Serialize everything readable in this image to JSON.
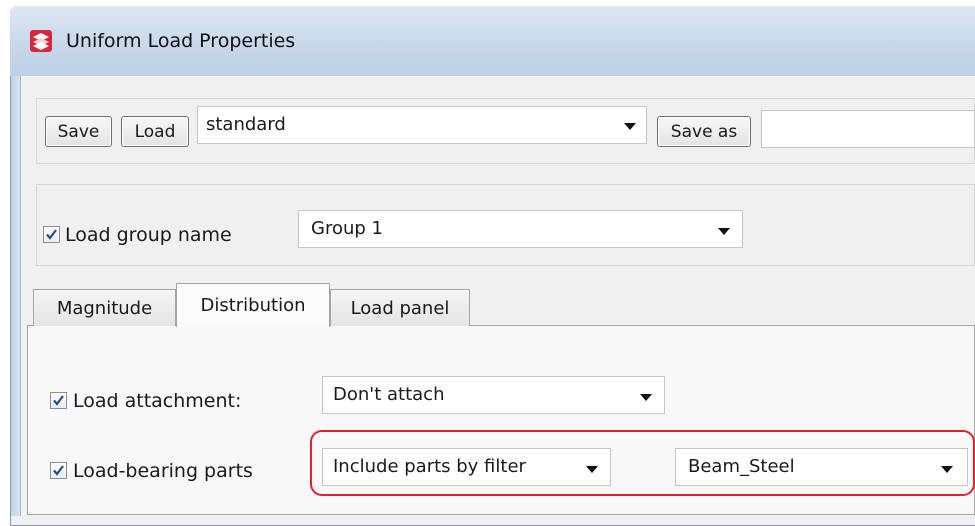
{
  "window": {
    "title": "Uniform Load Properties"
  },
  "toolbar": {
    "save_label": "Save",
    "load_label": "Load",
    "preset_value": "standard",
    "save_as_label": "Save as",
    "save_as_value": ""
  },
  "load_group": {
    "checked": true,
    "label": "Load group name",
    "value": "Group 1"
  },
  "tabs": [
    {
      "label": "Magnitude",
      "active": false
    },
    {
      "label": "Distribution",
      "active": true
    },
    {
      "label": "Load panel",
      "active": false
    }
  ],
  "distribution": {
    "attachment": {
      "checked": true,
      "label": "Load attachment:",
      "value": "Don't attach"
    },
    "bearing": {
      "checked": true,
      "label": "Load-bearing parts",
      "mode_value": "Include parts by filter",
      "filter_value": "Beam_Steel"
    }
  },
  "colors": {
    "highlight": "#e0222d",
    "accent": "#316ac5"
  }
}
